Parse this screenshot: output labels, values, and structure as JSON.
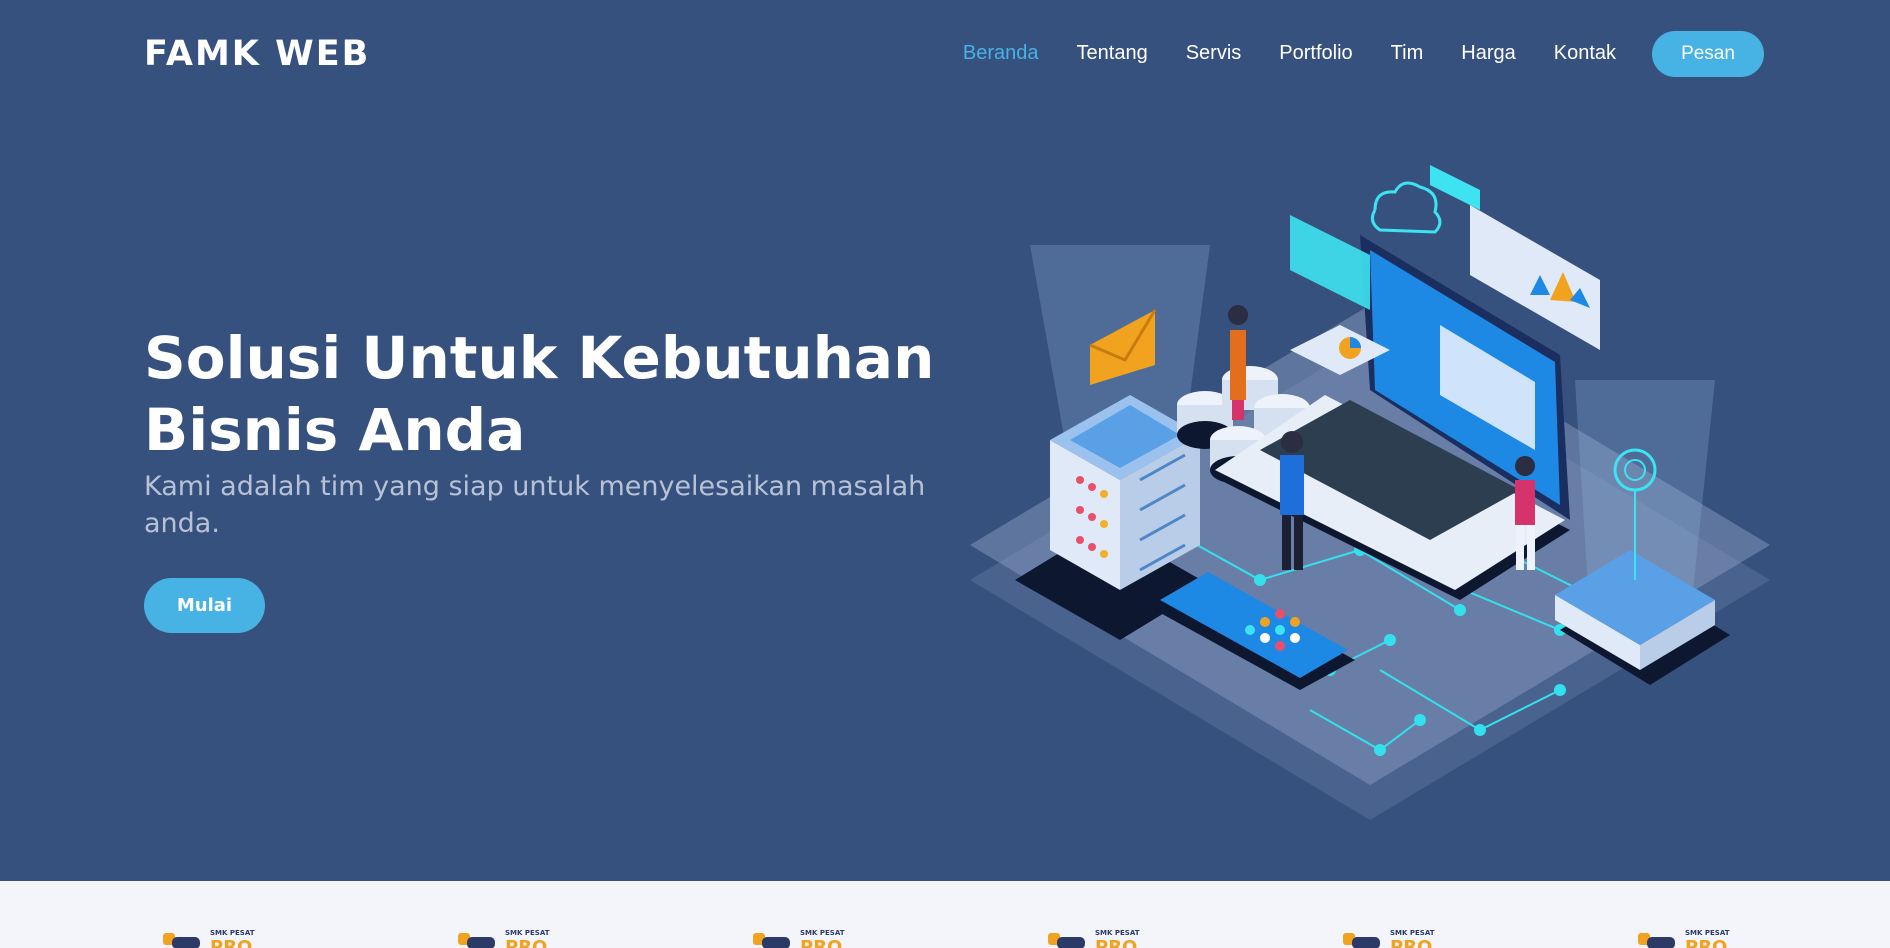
{
  "navbar": {
    "logo": "FAMK WEB",
    "links": [
      "Beranda",
      "Tentang",
      "Servis",
      "Portfolio",
      "Tim",
      "Harga",
      "Kontak"
    ],
    "active_link": "Beranda",
    "cta": "Pesan"
  },
  "hero": {
    "title_line1": "Solusi Untuk Kebutuhan",
    "title_line2": "Bisnis Anda",
    "subtitle": "Kami adalah tim yang siap untuk menyelesaikan masalah anda.",
    "cta": "Mulai",
    "illustration": "isometric-laptop-servers-illustration"
  },
  "clients": {
    "logo_text": "SMK PESAT",
    "logo_icon": "smk-pesat-logo",
    "count": 6
  },
  "colors": {
    "background": "#37517e",
    "accent": "#47b2e4",
    "text": "#ffffff",
    "muted": "#b7c2d6",
    "clients_bg": "#f3f5fa"
  }
}
